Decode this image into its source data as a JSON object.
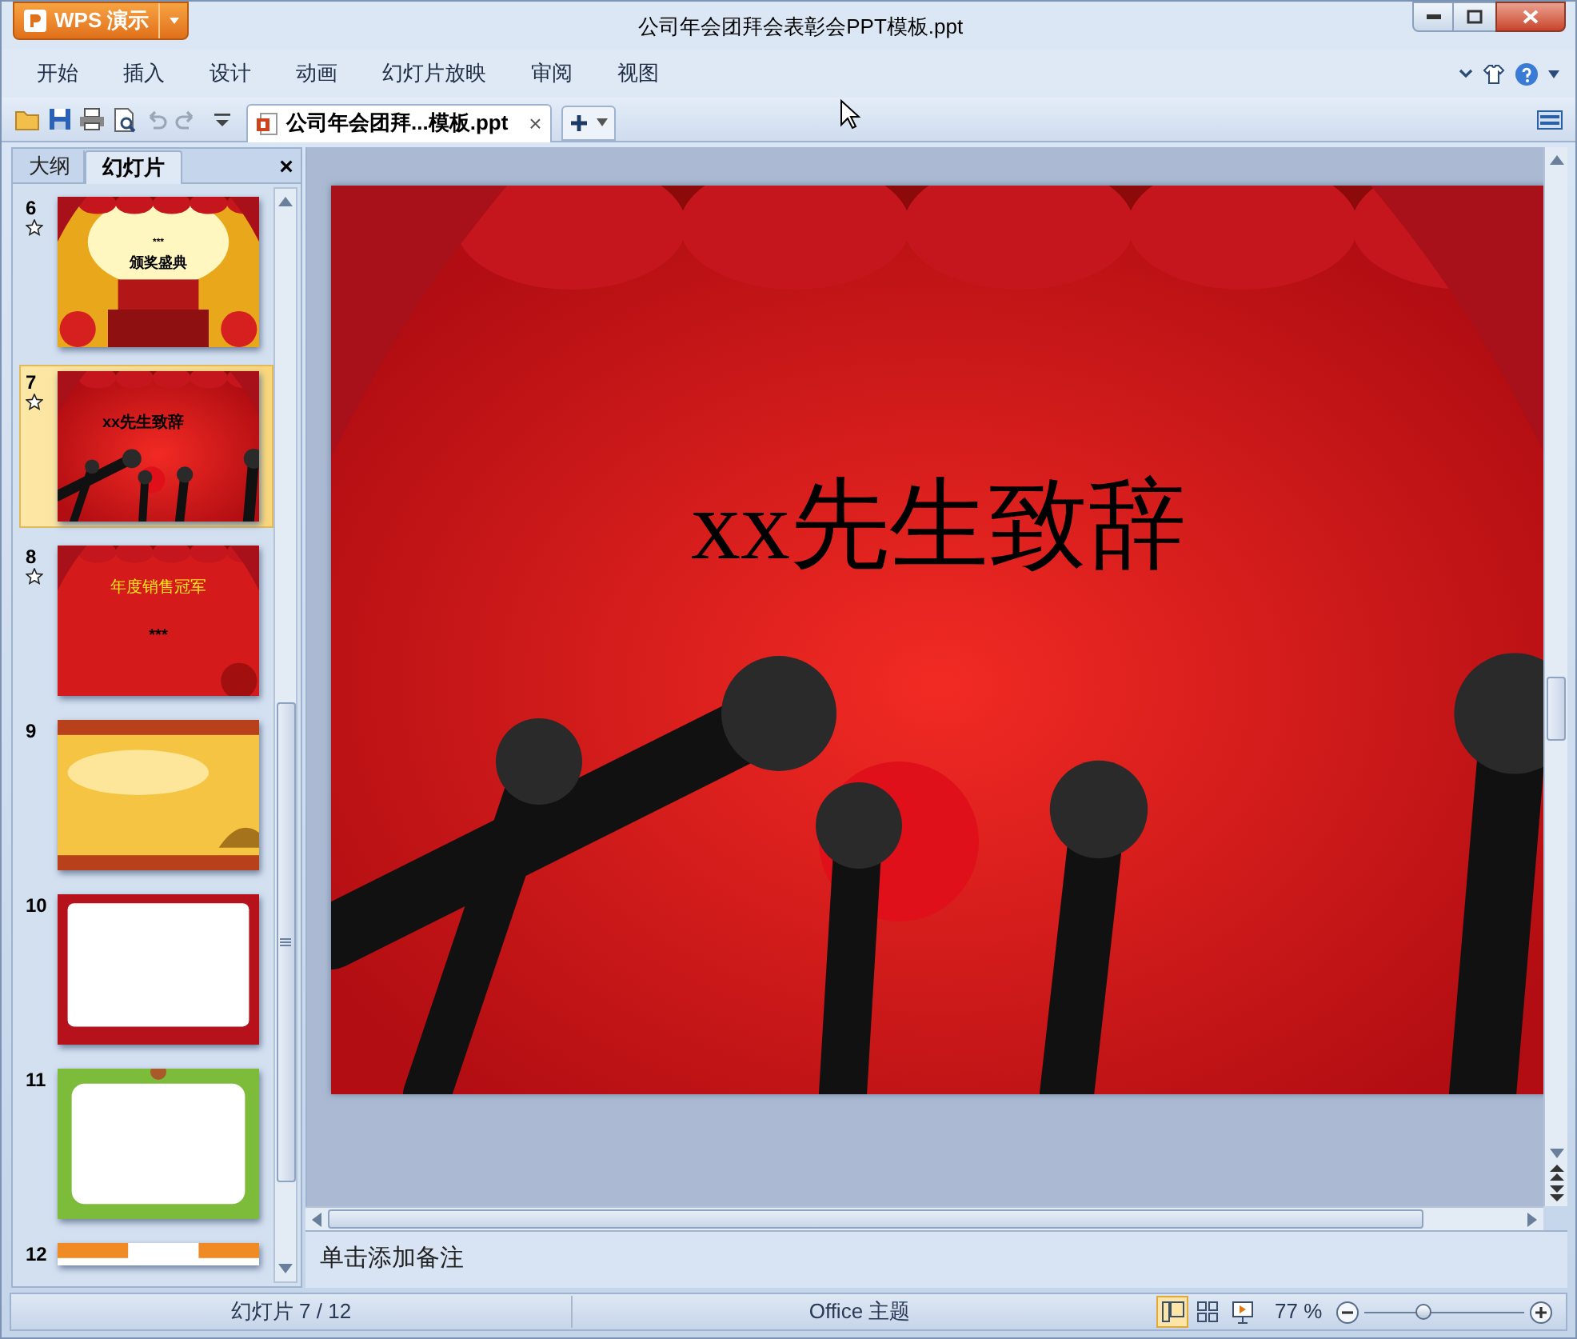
{
  "app_button": {
    "label": "WPS 演示"
  },
  "window": {
    "title": "公司年会团拜会表彰会PPT模板.ppt"
  },
  "menu": [
    "开始",
    "插入",
    "设计",
    "动画",
    "幻灯片放映",
    "审阅",
    "视图"
  ],
  "document_tab": {
    "label": "公司年会团拜...模板.ppt",
    "close": "×"
  },
  "panel_tabs": [
    {
      "label": "大纲",
      "selected": false
    },
    {
      "label": "幻灯片",
      "selected": true
    }
  ],
  "panel_close": "×",
  "slides": [
    {
      "number": "6",
      "animated": true,
      "selected": false,
      "kind": "stage",
      "texts": [
        "***",
        "颁奖盛典"
      ]
    },
    {
      "number": "7",
      "animated": true,
      "selected": true,
      "kind": "speech",
      "texts": [
        "xx先生致辞"
      ]
    },
    {
      "number": "8",
      "animated": true,
      "selected": false,
      "kind": "award",
      "texts": [
        "年度销售冠军",
        "***"
      ]
    },
    {
      "number": "9",
      "animated": false,
      "selected": false,
      "kind": "gold"
    },
    {
      "number": "10",
      "animated": false,
      "selected": false,
      "kind": "redframe"
    },
    {
      "number": "11",
      "animated": false,
      "selected": false,
      "kind": "leafframe"
    },
    {
      "number": "12",
      "animated": false,
      "selected": false,
      "kind": "orange"
    }
  ],
  "current_slide": {
    "title": "xx先生致辞"
  },
  "notes": {
    "placeholder": "单击添加备注"
  },
  "status_bar": {
    "slide_counter": "幻灯片 7 / 12",
    "theme": "Office 主题",
    "zoom": "77 %",
    "zoom_slider": {
      "level": 0.36
    },
    "views": [
      {
        "kind": "normal",
        "selected": true
      },
      {
        "kind": "sorter",
        "selected": false
      },
      {
        "kind": "show",
        "selected": false
      }
    ]
  }
}
